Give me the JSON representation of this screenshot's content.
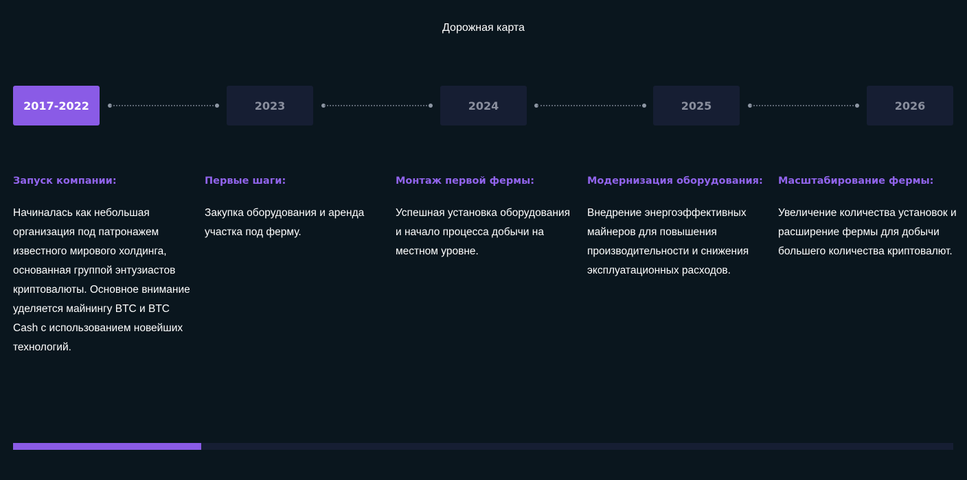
{
  "title": "Дорожная карта",
  "years": [
    {
      "label": "2017-2022",
      "active": true
    },
    {
      "label": "2023",
      "active": false
    },
    {
      "label": "2024",
      "active": false
    },
    {
      "label": "2025",
      "active": false
    },
    {
      "label": "2026",
      "active": false
    }
  ],
  "stages": [
    {
      "heading": "Запуск компании:",
      "text": "Начиналась как небольшая организация под патронажем известного мирового холдинга, основанная группой энтузиастов криптовалюты. Основное внимание уделяется майнингу BTC и BTC Cash с использованием новейших технологий."
    },
    {
      "heading": "Первые шаги:",
      "text": "Закупка оборудования и аренда участка под ферму."
    },
    {
      "heading": "Монтаж первой фермы:",
      "text": "Успешная установка оборудования и начало процесса добычи на местном уровне."
    },
    {
      "heading": "Модернизация оборудования:",
      "text": "Внедрение энергоэффективных майнеров для повышения производительности и снижения эксплуатационных расходов."
    },
    {
      "heading": "Масштабирование фермы:",
      "text": "Увеличение количества установок и расширение фермы для добычи большего количества криптовалют."
    }
  ],
  "progress": {
    "fraction": 0.2
  },
  "colors": {
    "background": "#0a161e",
    "accent": "#8a5be6",
    "heading": "#9164ec",
    "inactive_tab": "#161e33",
    "inactive_text": "#8a8f9e"
  }
}
